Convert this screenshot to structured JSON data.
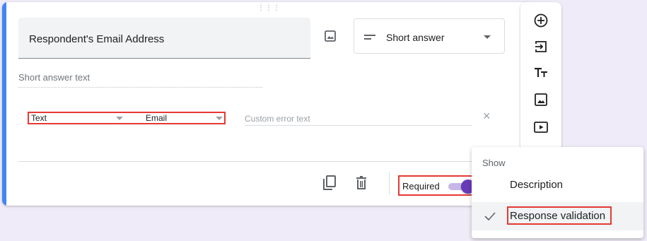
{
  "question": {
    "title": "Respondent's Email Address",
    "type_label": "Short answer",
    "answer_placeholder": "Short answer text"
  },
  "validation": {
    "rule_type": "Text",
    "rule_condition": "Email",
    "error_placeholder": "Custom error text"
  },
  "footer": {
    "required_label": "Required",
    "required_on": true
  },
  "tools": [
    "add-question-icon",
    "import-questions-icon",
    "add-title-icon",
    "add-image-icon",
    "add-video-icon"
  ],
  "menu": {
    "header": "Show",
    "items": [
      {
        "label": "Description",
        "checked": false
      },
      {
        "label": "Response validation",
        "checked": true
      }
    ]
  },
  "colors": {
    "accent": "#4285f4",
    "toggle": "#673ab7",
    "highlight": "#e53935",
    "background": "#f0ebf8"
  }
}
